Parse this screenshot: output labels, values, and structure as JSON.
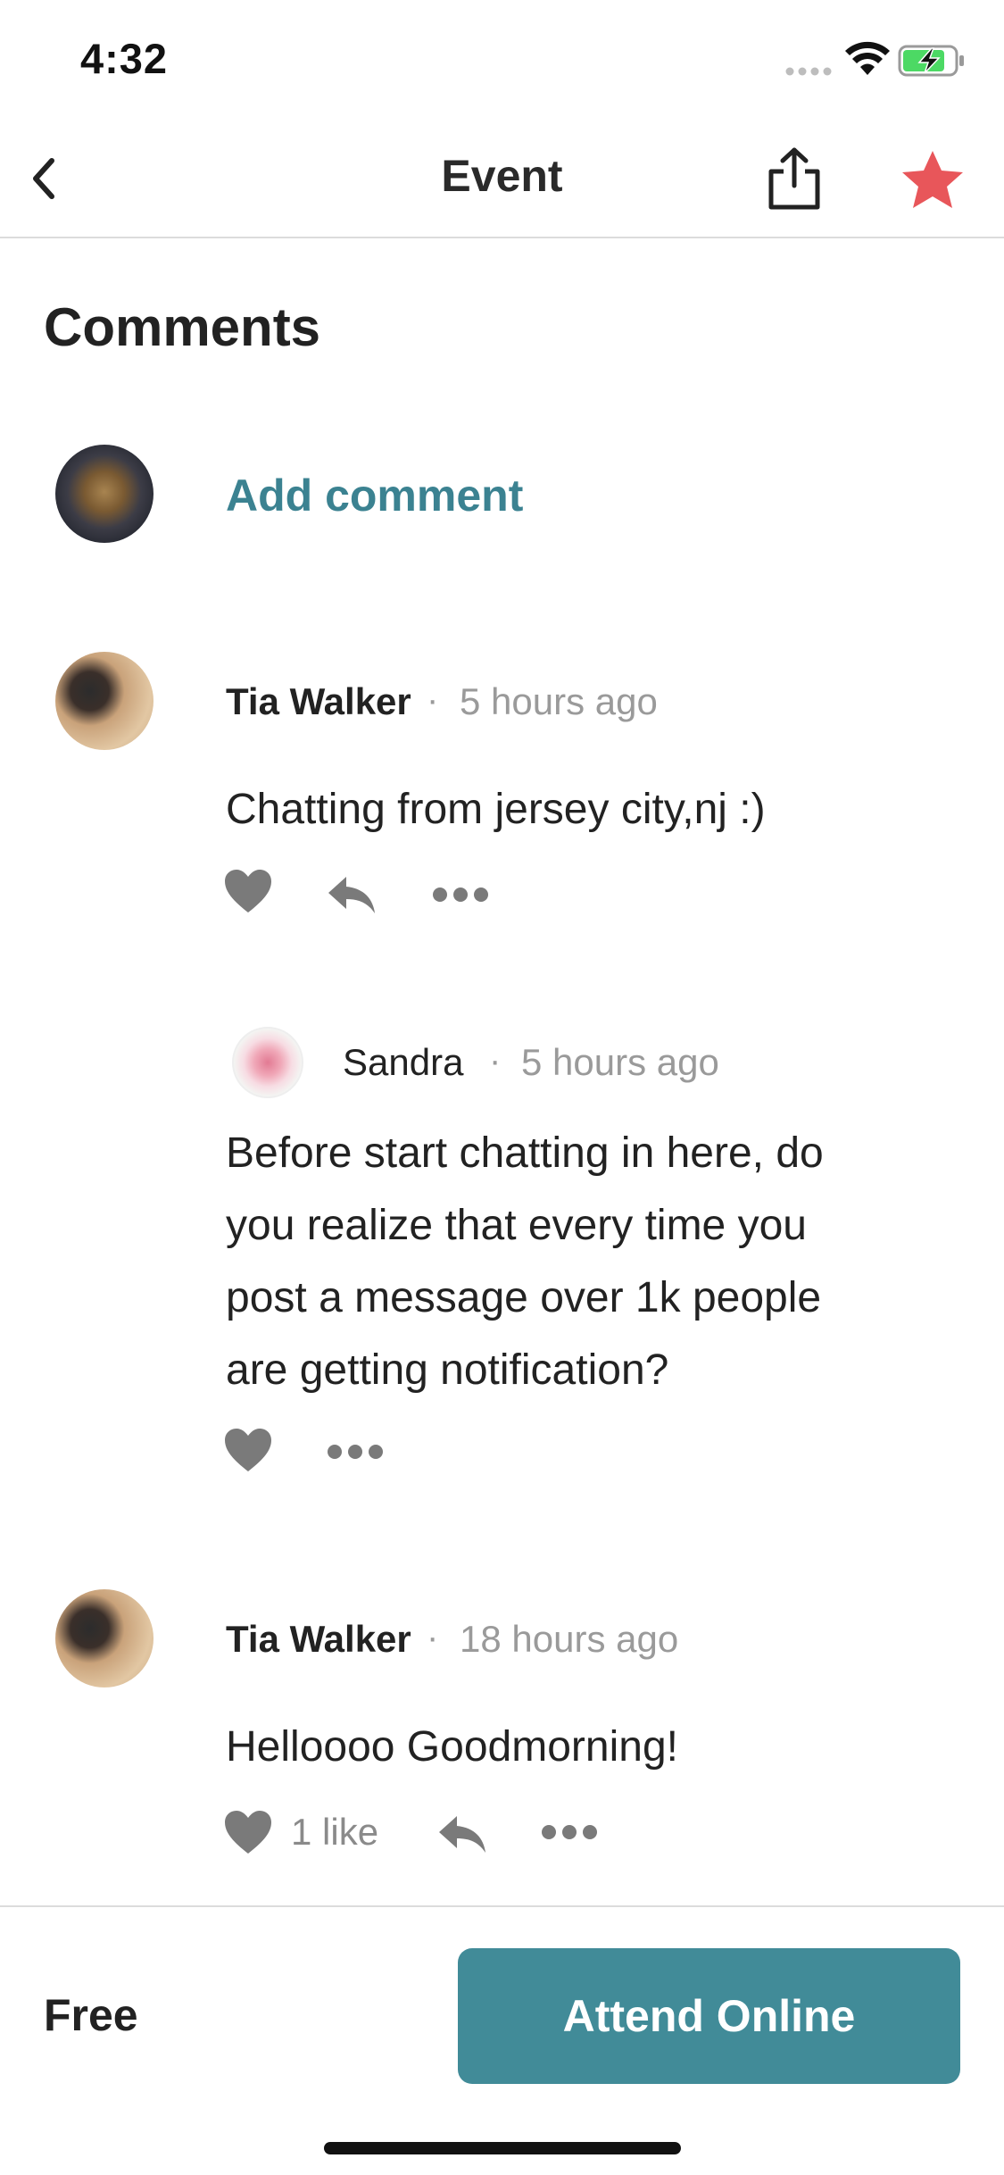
{
  "status_bar": {
    "time": "4:32"
  },
  "nav": {
    "title": "Event",
    "back_icon": "chevron-left-icon",
    "share_icon": "share-icon",
    "favorite_icon": "star-icon",
    "favorite_color": "#e8565a"
  },
  "comments_section": {
    "title": "Comments",
    "add_comment_label": "Add comment"
  },
  "comments": [
    {
      "author": "Tia Walker",
      "separator": "·",
      "time": "5 hours ago",
      "text": "Chatting from jersey city,nj :)"
    },
    {
      "author": "Sandra",
      "separator": "·",
      "time": "5 hours ago",
      "text_lines": [
        "Before start chatting in here, do",
        "you realize that every time you",
        "post a message over 1k people",
        "are getting notification?"
      ]
    },
    {
      "author": "Tia Walker",
      "separator": "·",
      "time": "18 hours ago",
      "text": "Helloooo Goodmorning!",
      "likes_label": "1 like"
    }
  ],
  "footer": {
    "price": "Free",
    "attend_label": "Attend Online"
  },
  "colors": {
    "accent": "#418b98",
    "link": "#3b8291",
    "muted": "#9a9a9a",
    "icon_gray": "#7a7a7a"
  }
}
